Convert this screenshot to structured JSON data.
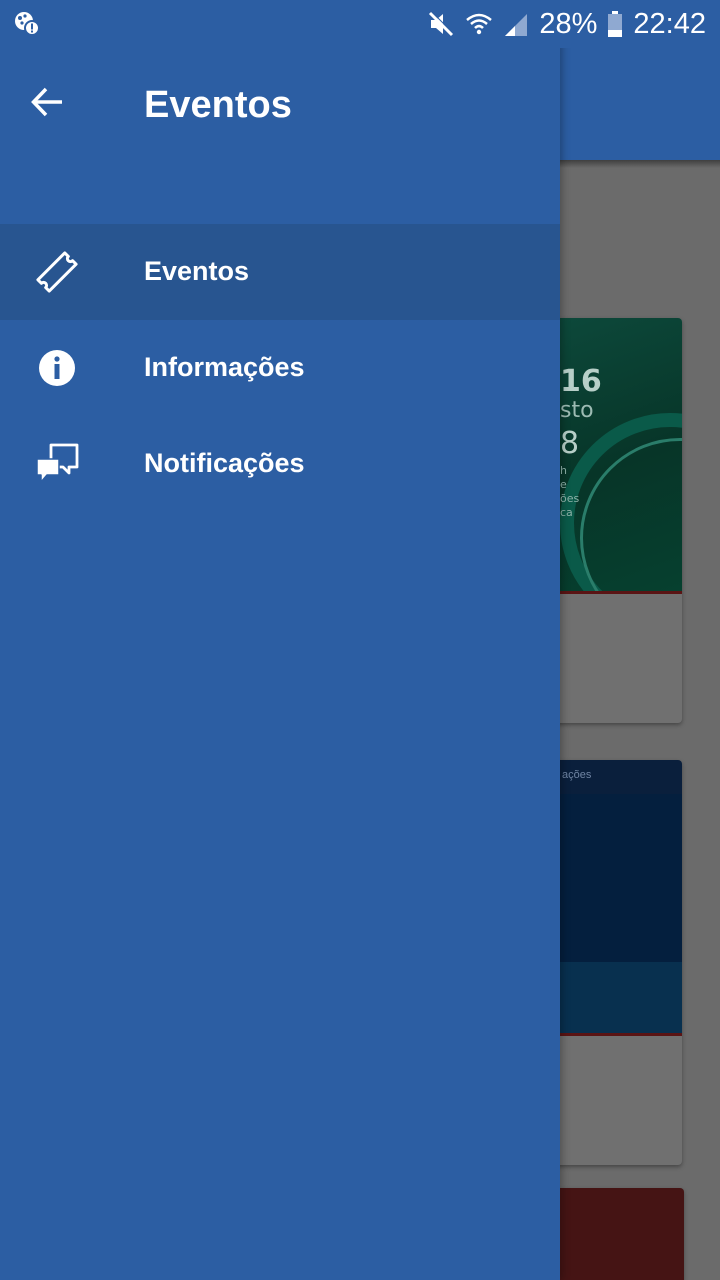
{
  "status_bar": {
    "battery_percent": "28%",
    "time": "22:42",
    "icons": [
      "notification-alert-icon",
      "mute-icon",
      "wifi-icon",
      "signal-icon",
      "battery-icon"
    ]
  },
  "drawer": {
    "title": "Eventos",
    "back_icon": "arrow-left-icon",
    "items": [
      {
        "label": "Eventos",
        "icon": "ticket-icon",
        "active": true
      },
      {
        "label": "Informações",
        "icon": "info-icon",
        "active": false
      },
      {
        "label": "Notificações",
        "icon": "chat-bubbles-icon",
        "active": false
      }
    ]
  },
  "background": {
    "card1": {
      "line1": "16",
      "line2": "sto",
      "line3": "8",
      "small": "h\ne\nões\nca"
    },
    "card2": {
      "header": "ações"
    }
  },
  "colors": {
    "primary": "#2c5ea3",
    "active_item": "#285590",
    "text": "#ffffff",
    "scrim_bg": "#6b6b6b"
  }
}
